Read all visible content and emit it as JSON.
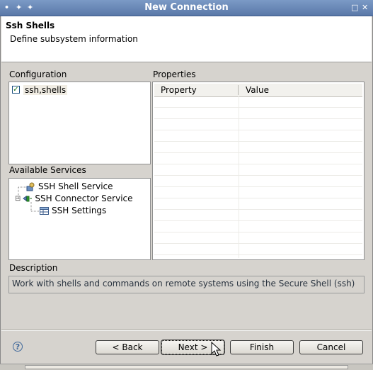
{
  "window": {
    "title": "New Connection",
    "menu_icon": "•",
    "pin_icon": "✦",
    "pin2_icon": "✦",
    "maximize_icon": "□",
    "close_icon": "✕"
  },
  "header": {
    "title": "Ssh Shells",
    "subtitle": "Define subsystem information"
  },
  "configuration": {
    "label": "Configuration",
    "items": [
      {
        "label": "ssh,shells",
        "checked": true
      }
    ]
  },
  "available_services": {
    "label": "Available Services",
    "tree": [
      {
        "label": "SSH Shell Service"
      },
      {
        "label": "SSH Connector Service",
        "expanded": true,
        "expander": "⊟"
      },
      {
        "label": "SSH Settings"
      }
    ]
  },
  "properties": {
    "label": "Properties",
    "columns": [
      "Property",
      "Value"
    ]
  },
  "description": {
    "label": "Description",
    "text": "Work with shells and commands on remote systems using the Secure Shell (ssh)"
  },
  "buttons": {
    "help": "?",
    "back": "< Back",
    "next": "Next >",
    "finish": "Finish",
    "cancel": "Cancel"
  }
}
